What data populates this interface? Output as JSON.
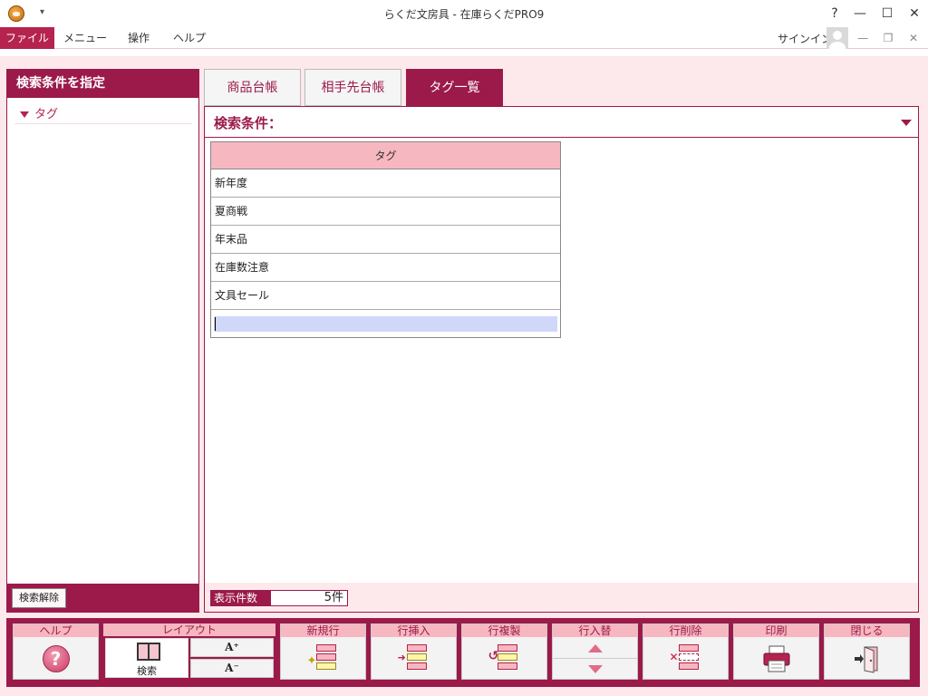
{
  "window": {
    "title": "らくだ文房具 - 在庫らくだPRO9",
    "help_glyph": "?",
    "minimize_glyph": "—",
    "maximize_glyph": "☐",
    "close_glyph": "✕"
  },
  "menubar": {
    "items": [
      "ファイル",
      "メニュー",
      "操作",
      "ヘルプ"
    ],
    "active_index": 0,
    "signin_label": "サインイン",
    "mdi_minimize": "—",
    "mdi_restore": "❐",
    "mdi_close": "✕"
  },
  "left_panel": {
    "title": "検索条件を指定",
    "tree_items": [
      "タグ"
    ],
    "clear_button": "検索解除"
  },
  "tabs": [
    "商品台帳",
    "相手先台帳",
    "タグ一覧"
  ],
  "active_tab_index": 2,
  "search": {
    "label": "検索条件："
  },
  "grid": {
    "column_header": "タグ",
    "rows": [
      "新年度",
      "夏商戦",
      "年末品",
      "在庫数注意",
      "文具セール"
    ],
    "edit_value": ""
  },
  "count": {
    "label": "表示件数",
    "value": "5件"
  },
  "toolbar": {
    "help": "ヘルプ",
    "help_glyph": "?",
    "layout": "レイアウト",
    "layout_search": "検索",
    "font_larger": "A⁺",
    "font_smaller": "A⁻",
    "new_row": "新規行",
    "insert_row": "行挿入",
    "copy_row": "行複製",
    "swap_row": "行入替",
    "delete_row": "行削除",
    "print": "印刷",
    "close": "閉じる"
  },
  "colors": {
    "accent": "#9b1a4a",
    "accent_light": "#f7b7c0",
    "background": "#fde9ec",
    "menu_active": "#b5234e",
    "edit_row": "#d0d8fa"
  },
  "icons": [
    "app-logo-icon",
    "quick-access-arrow-icon",
    "avatar-icon",
    "help-icon",
    "layout-split-icon",
    "new-row-icon",
    "insert-row-icon",
    "copy-row-icon",
    "swap-up-icon",
    "swap-down-icon",
    "delete-row-icon",
    "printer-icon",
    "exit-door-icon",
    "dropdown-arrow-icon",
    "tree-expand-icon"
  ]
}
